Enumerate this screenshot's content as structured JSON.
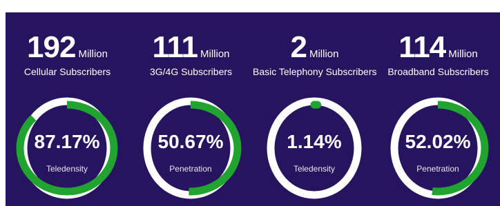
{
  "colors": {
    "background": "#26145e",
    "ring_track": "#ffffff",
    "ring_fill": "#21a330",
    "text": "#ffffff"
  },
  "stats": [
    {
      "value": "192",
      "unit": "Million",
      "label": "Cellular Subscribers",
      "percent_text": "87.17%",
      "percent": 87.17,
      "caption": "Teledensity"
    },
    {
      "value": "111",
      "unit": "Million",
      "label": "3G/4G Subscribers",
      "percent_text": "50.67%",
      "percent": 50.67,
      "caption": "Penetration"
    },
    {
      "value": "2",
      "unit": "Million",
      "label": "Basic Telephony Subscribers",
      "percent_text": "1.14%",
      "percent": 1.14,
      "caption": "Teledensity"
    },
    {
      "value": "114",
      "unit": "Million",
      "label": "Broadband Subscribers",
      "percent_text": "52.02%",
      "percent": 52.02,
      "caption": "Penetration"
    }
  ]
}
